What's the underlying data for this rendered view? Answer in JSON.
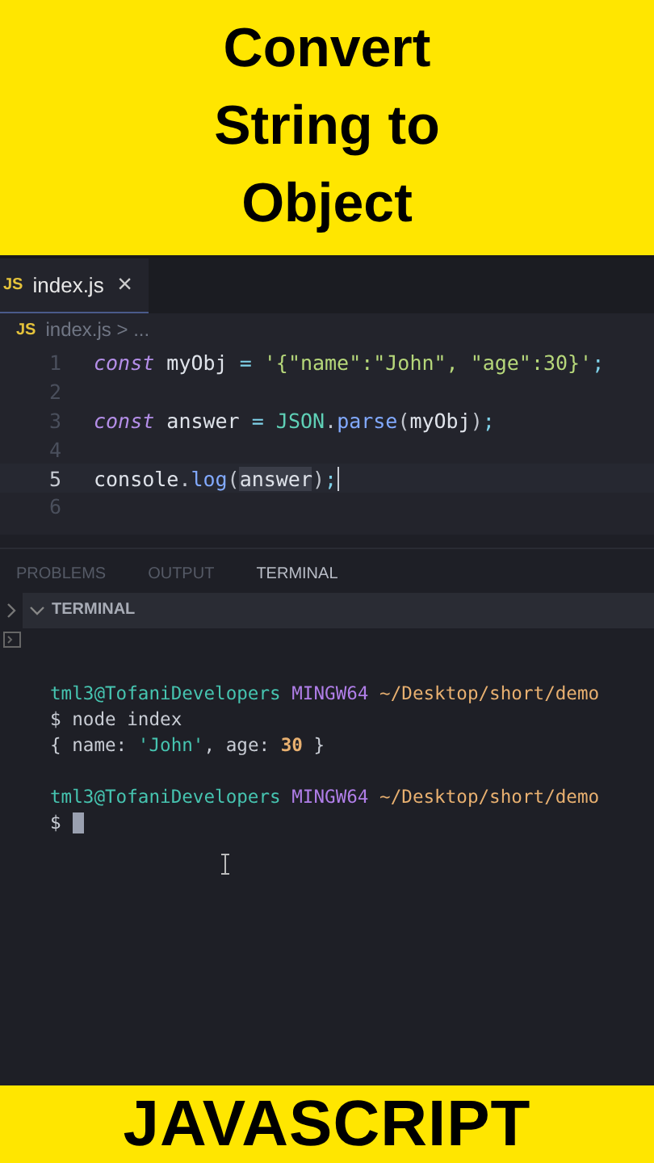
{
  "title_banner": {
    "lines": [
      "Convert",
      "String to",
      "Object"
    ]
  },
  "editor_tabs": [
    {
      "icon_text": "JS",
      "label": "index.js",
      "close": "×",
      "selected": true
    }
  ],
  "breadcrumb": {
    "icon_text": "JS",
    "path": "index.js > ..."
  },
  "code_lines": [
    {
      "number": "1",
      "current": false,
      "tokens": [
        {
          "kind": "keyword",
          "text": "const"
        },
        {
          "kind": "plain",
          "text": " myObj "
        },
        {
          "kind": "operator",
          "text": "= "
        },
        {
          "kind": "string",
          "text": "'{\"name\":\"John\", \"age\":30}'"
        },
        {
          "kind": "operator",
          "text": ";"
        }
      ]
    },
    {
      "number": "2",
      "current": false
    },
    {
      "number": "3",
      "current": false,
      "tokens": [
        {
          "kind": "keyword",
          "text": "const"
        },
        {
          "kind": "plain",
          "text": " answer "
        },
        {
          "kind": "operator",
          "text": "= "
        },
        {
          "kind": "class",
          "text": "JSON"
        },
        {
          "kind": "punct",
          "text": "."
        },
        {
          "kind": "function",
          "text": "parse"
        },
        {
          "kind": "punct",
          "text": "("
        },
        {
          "kind": "plain",
          "text": "myObj"
        },
        {
          "kind": "punct",
          "text": ")"
        },
        {
          "kind": "operator",
          "text": ";"
        }
      ]
    },
    {
      "number": "4",
      "current": false
    },
    {
      "number": "5",
      "current": true,
      "tokens": [
        {
          "kind": "plain",
          "text": "console"
        },
        {
          "kind": "punct",
          "text": "."
        },
        {
          "kind": "function",
          "text": "log"
        },
        {
          "kind": "punct",
          "text": "("
        },
        {
          "kind": "highlight",
          "text": "answer"
        },
        {
          "kind": "punct",
          "text": ")"
        },
        {
          "kind": "operator",
          "text": ";"
        }
      ]
    },
    {
      "number": "6",
      "current": false
    }
  ],
  "panel_tabs": [
    {
      "label": "PROBLEMS",
      "selected": false
    },
    {
      "label": "OUTPUT",
      "selected": false
    },
    {
      "label": "TERMINAL",
      "selected": true
    }
  ],
  "terminal": {
    "header": "TERMINAL",
    "lines": [
      {
        "kind": "blank"
      },
      {
        "kind": "prompt",
        "tokens": [
          {
            "kind": "user",
            "text": "tml3@TofaniDevelopers"
          },
          {
            "kind": "host",
            "text": " MINGW64 "
          },
          {
            "kind": "path",
            "text": "~/Desktop/short/demo"
          }
        ]
      },
      {
        "kind": "text",
        "tokens": [
          {
            "kind": "plain",
            "text": "$ node index"
          }
        ]
      },
      {
        "kind": "text",
        "tokens": [
          {
            "kind": "plain",
            "text": "{ name: "
          },
          {
            "kind": "string",
            "text": "'John'"
          },
          {
            "kind": "plain",
            "text": ", age: "
          },
          {
            "kind": "number",
            "text": "30"
          },
          {
            "kind": "plain",
            "text": " }"
          }
        ]
      },
      {
        "kind": "blank"
      },
      {
        "kind": "prompt",
        "tokens": [
          {
            "kind": "user",
            "text": "tml3@TofaniDevelopers"
          },
          {
            "kind": "host",
            "text": " MINGW64 "
          },
          {
            "kind": "path",
            "text": "~/Desktop/short/demo"
          }
        ]
      },
      {
        "kind": "input",
        "tokens": [
          {
            "kind": "plain",
            "text": "$"
          }
        ]
      }
    ]
  },
  "bottom_banner": {
    "text": "JAVASCRIPT"
  }
}
